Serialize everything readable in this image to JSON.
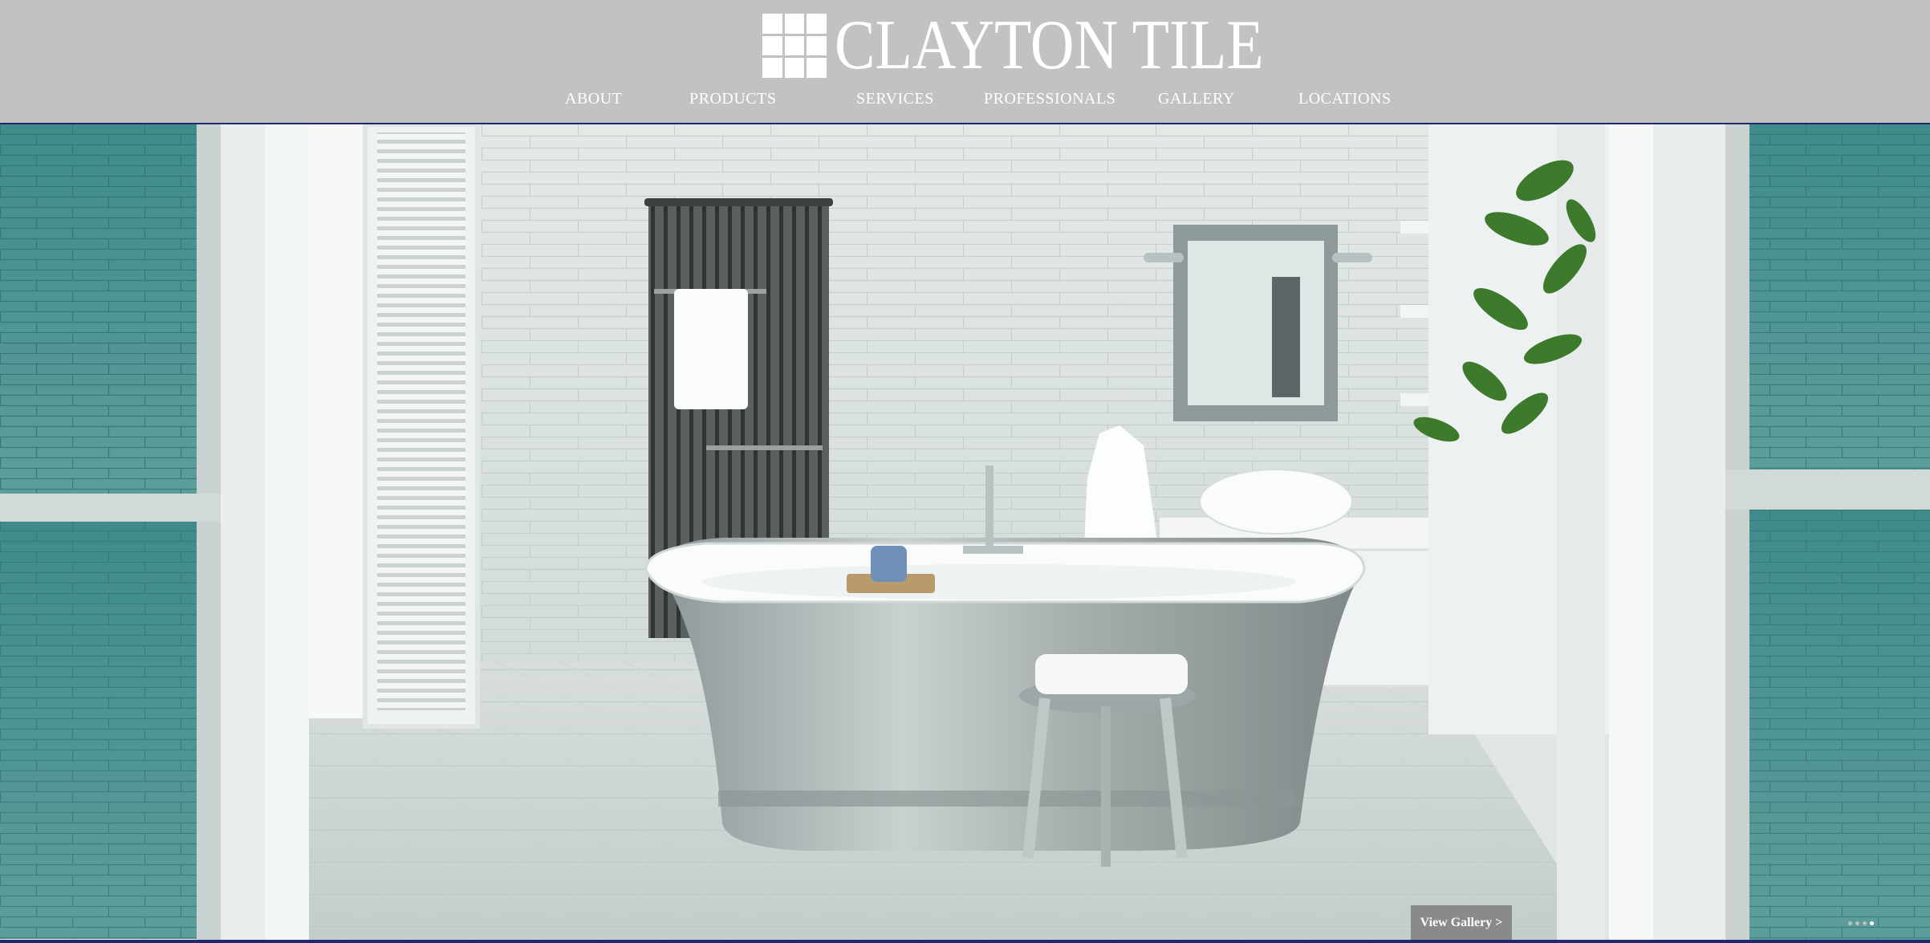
{
  "brand": {
    "name": "CLAYTON TILE",
    "logo_icon": "tile-grid-icon"
  },
  "nav": {
    "items": [
      {
        "label": "ABOUT"
      },
      {
        "label": "PRODUCTS"
      },
      {
        "label": "SERVICES"
      },
      {
        "label": "PROFESSIONALS"
      },
      {
        "label": "GALLERY"
      },
      {
        "label": "LOCATIONS"
      }
    ]
  },
  "hero": {
    "image_description_icon": "bathroom-photo",
    "cta_label": "View Gallery >",
    "slides_total": 4,
    "active_slide": 4
  },
  "colors": {
    "header_bg": "#c2c2c2",
    "nav_rule": "#1f2a6e",
    "cta_bg": "#8a8a8a",
    "text_on_dark": "#ffffff"
  }
}
